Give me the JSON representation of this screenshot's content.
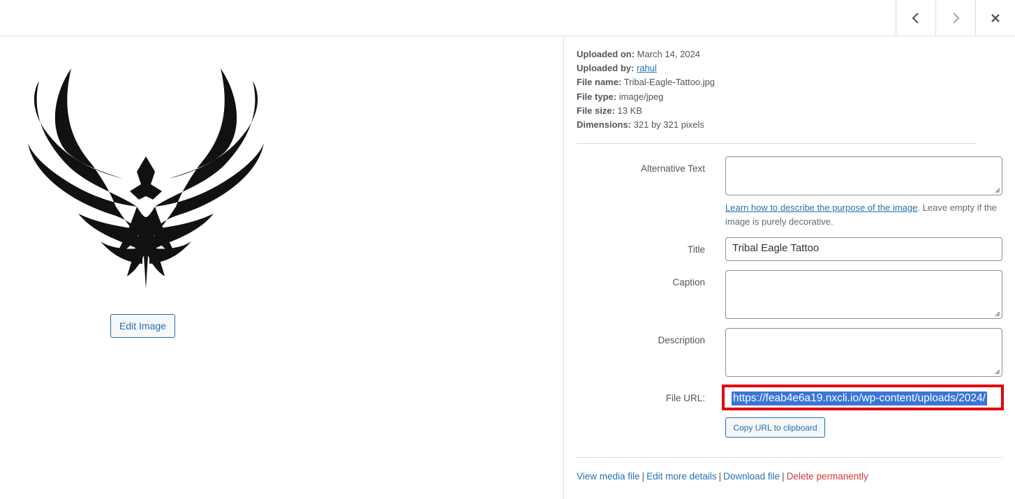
{
  "nav": {
    "prev_icon": "chevron-left-icon",
    "next_icon": "chevron-right-icon",
    "close_icon": "close-icon"
  },
  "preview": {
    "edit_button": "Edit Image",
    "image_alt": "Tribal Eagle Tattoo"
  },
  "details": {
    "uploaded_on_label": "Uploaded on:",
    "uploaded_on": "March 14, 2024",
    "uploaded_by_label": "Uploaded by:",
    "uploaded_by": "rahul",
    "file_name_label": "File name:",
    "file_name": "Tribal-Eagle-Tattoo.jpg",
    "file_type_label": "File type:",
    "file_type": "image/jpeg",
    "file_size_label": "File size:",
    "file_size": "13 KB",
    "dimensions_label": "Dimensions:",
    "dimensions": "321 by 321 pixels"
  },
  "form": {
    "alt_text_label": "Alternative Text",
    "alt_text_value": "",
    "alt_help_link": "Learn how to describe the purpose of the image",
    "alt_help_text": ". Leave empty if the image is purely decorative.",
    "title_label": "Title",
    "title_value": "Tribal Eagle Tattoo",
    "caption_label": "Caption",
    "caption_value": "",
    "description_label": "Description",
    "description_value": "",
    "file_url_label": "File URL:",
    "file_url_value": "https://feab4e6a19.nxcli.io/wp-content/uploads/2024/",
    "copy_button": "Copy URL to clipboard"
  },
  "actions": {
    "view": "View media file",
    "edit_more": "Edit more details",
    "download": "Download file",
    "delete": "Delete permanently",
    "separator": "|"
  },
  "colors": {
    "link": "#2271b1",
    "danger": "#d63638",
    "highlight_border": "#e3000f",
    "selection": "#3875d7"
  }
}
